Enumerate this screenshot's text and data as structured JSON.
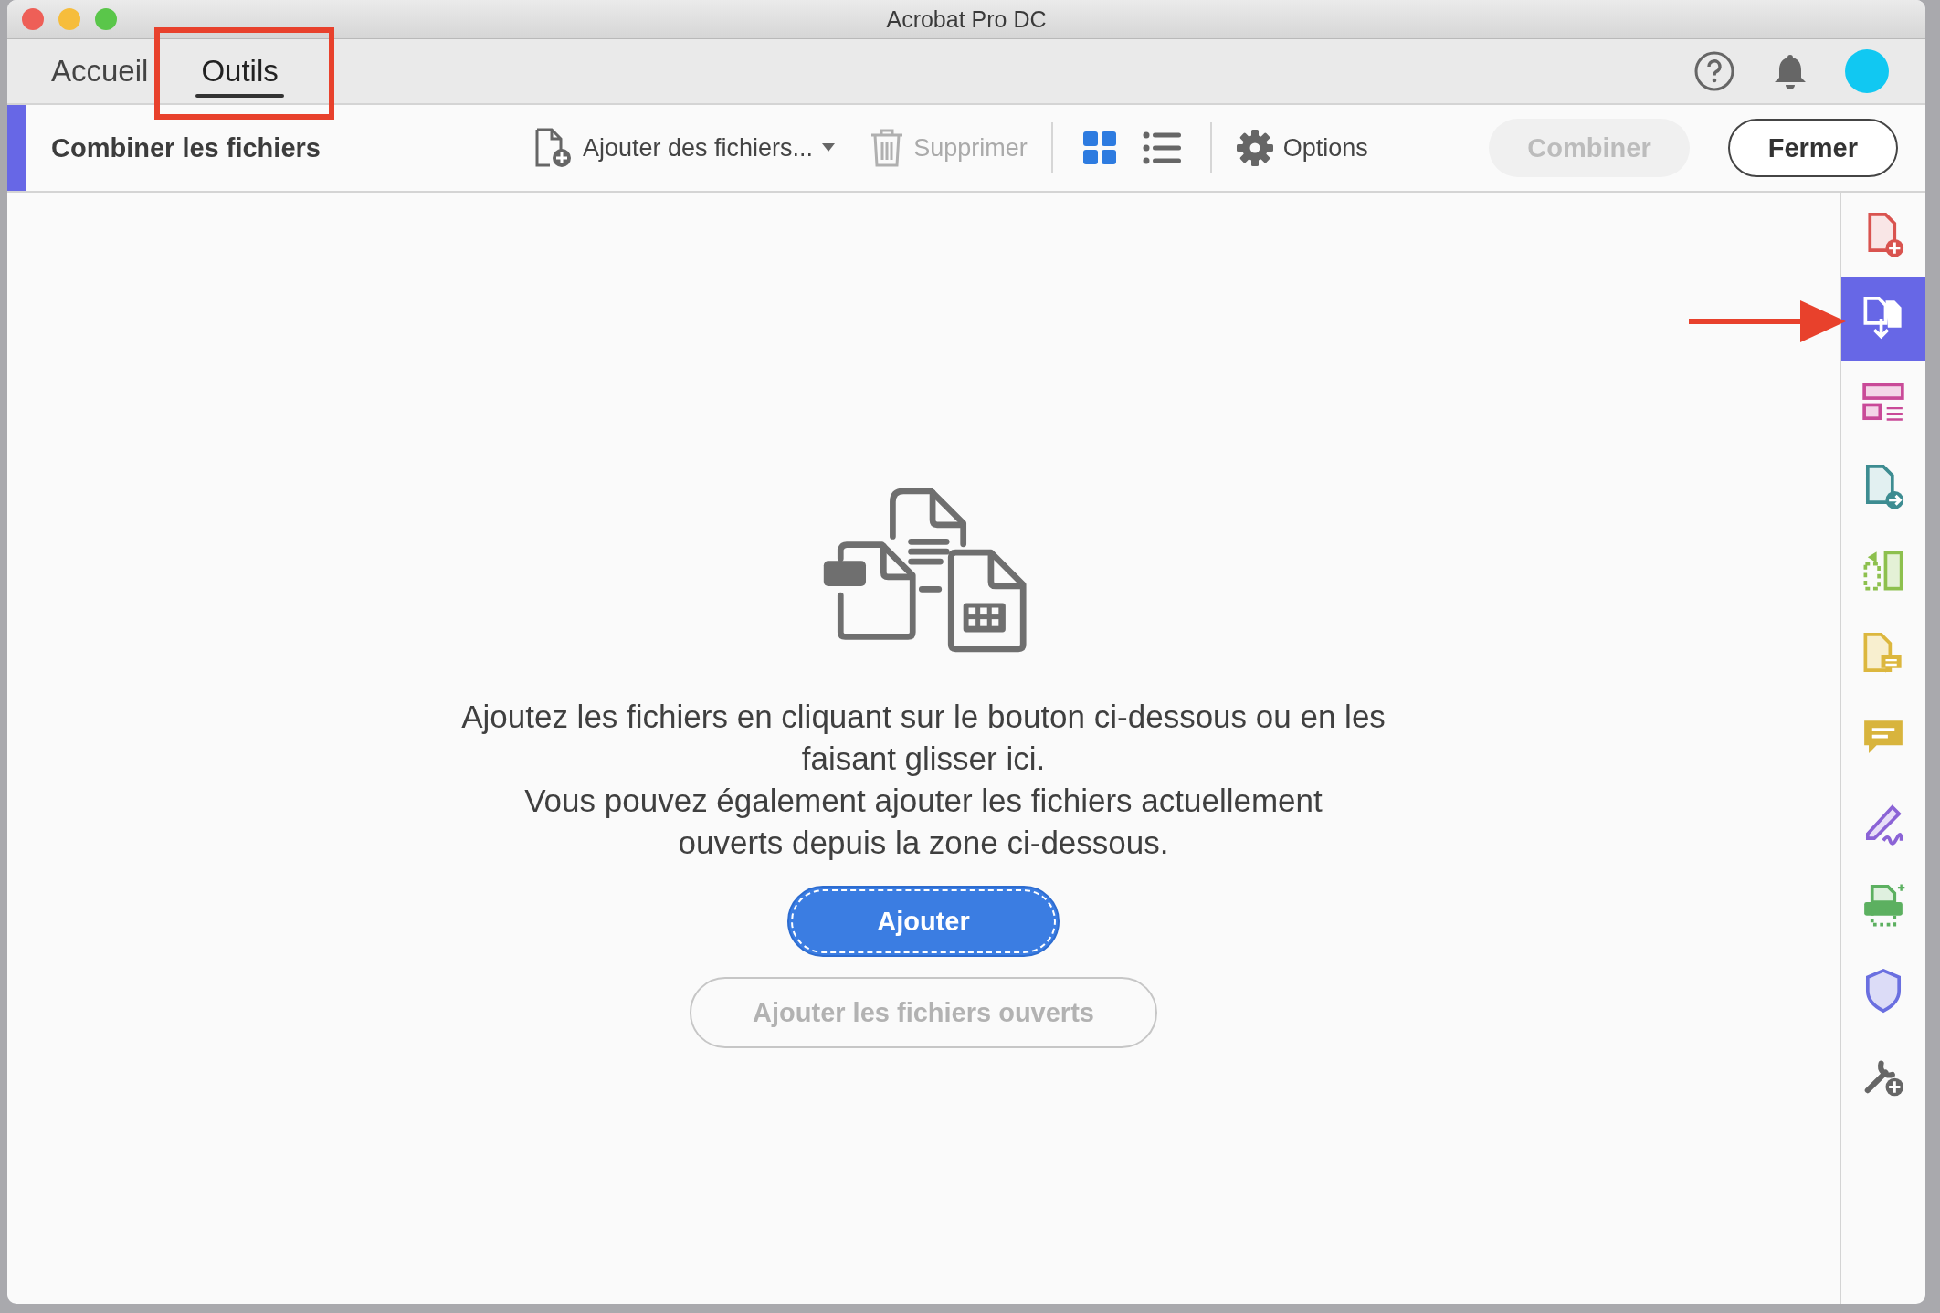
{
  "window": {
    "title": "Acrobat Pro DC"
  },
  "tabs": [
    {
      "label": "Accueil",
      "selected": false
    },
    {
      "label": "Outils",
      "selected": true
    }
  ],
  "toolbar": {
    "title": "Combiner les fichiers",
    "add_files": "Ajouter des fichiers...",
    "delete": {
      "label": "Supprimer",
      "disabled": true
    },
    "views": [
      {
        "kind": "grid",
        "selected": true
      },
      {
        "kind": "list",
        "selected": false
      }
    ],
    "options": "Options",
    "combine": {
      "label": "Combiner",
      "disabled": true
    },
    "close": "Fermer"
  },
  "message": [
    "Ajoutez les fichiers en cliquant sur le bouton ci-dessous ou en les faisant glisser ici.",
    "Vous pouvez également ajouter les fichiers actuellement ouverts depuis la zone ci-dessous."
  ],
  "add_button": "Ajouter",
  "add_open_button": {
    "label": "Ajouter les fichiers ouverts",
    "disabled": true
  },
  "tools": [
    {
      "kind": "create",
      "selected": false
    },
    {
      "kind": "combine",
      "selected": true
    },
    {
      "kind": "layout",
      "selected": false
    },
    {
      "kind": "export",
      "selected": false
    },
    {
      "kind": "organize",
      "selected": false
    },
    {
      "kind": "comment-doc",
      "selected": false
    },
    {
      "kind": "comment",
      "selected": false
    },
    {
      "kind": "sign",
      "selected": false
    },
    {
      "kind": "print",
      "selected": false
    },
    {
      "kind": "protect",
      "selected": false
    },
    {
      "kind": "more",
      "selected": false
    }
  ]
}
